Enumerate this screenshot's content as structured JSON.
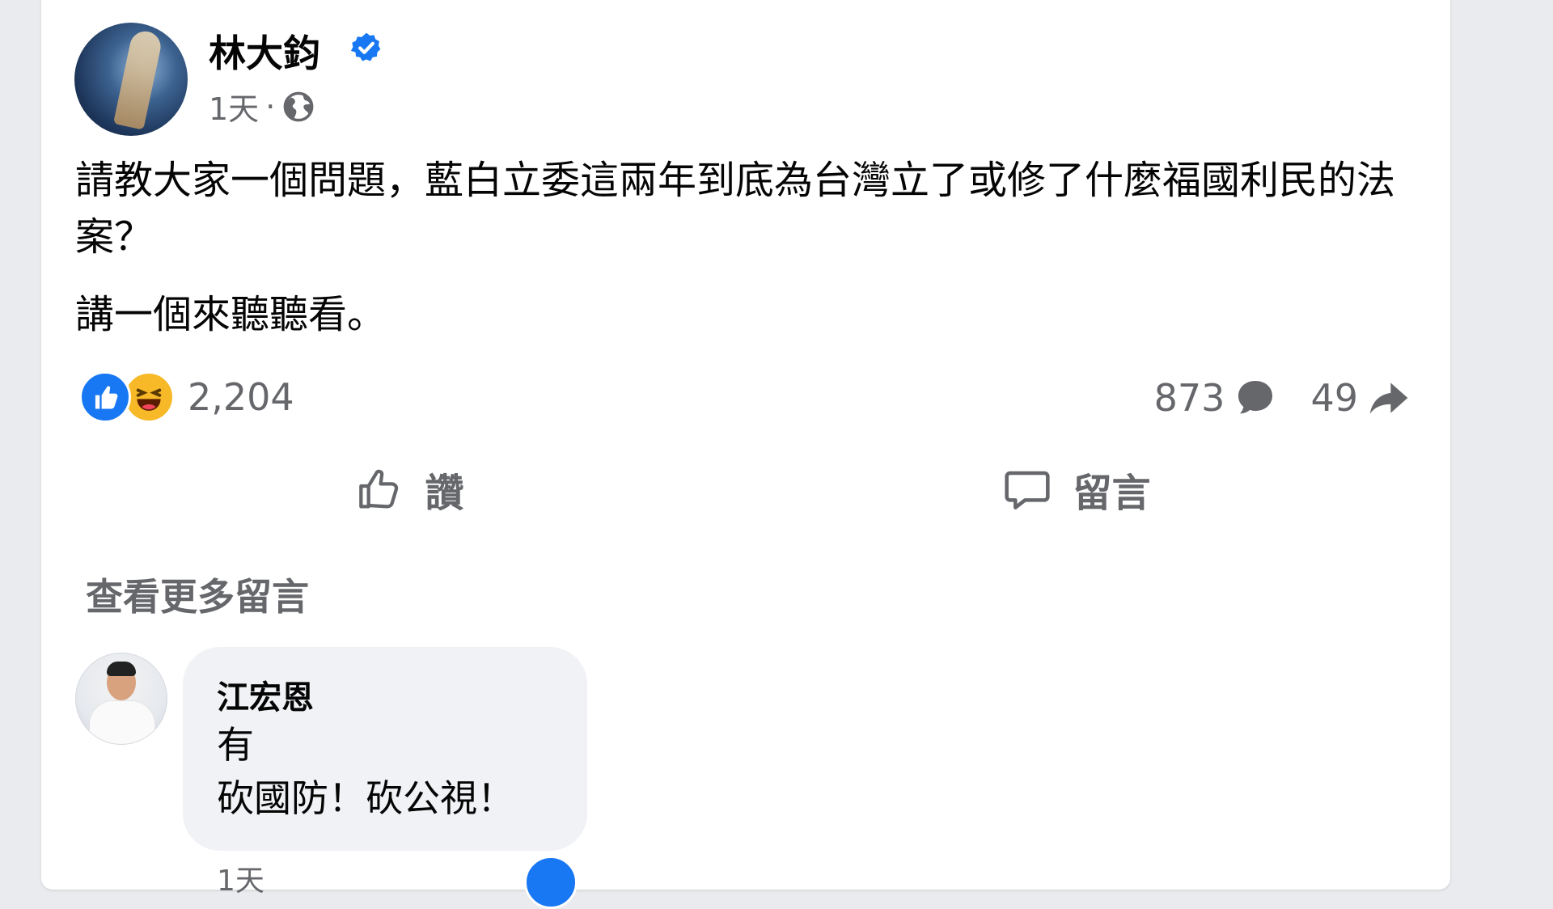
{
  "post": {
    "author": "林大鈞",
    "time": "1天",
    "separator": "·",
    "paragraphs": [
      "請教大家一個問題，藍白立委這兩年到底為台灣立了或修了什麼福國利民的法案？",
      "講一個來聽聽看。"
    ],
    "reaction_count": "2,204",
    "comment_count": "873",
    "share_count": "49"
  },
  "actions": {
    "like_label": "讚",
    "comment_label": "留言"
  },
  "comments": {
    "more_label": "查看更多留言",
    "items": [
      {
        "name": "江宏恩",
        "lines": [
          "有",
          "砍國防！砍公視！"
        ],
        "time": "1天"
      }
    ]
  },
  "colors": {
    "brand_blue": "#1877f2",
    "haha_yellow": "#f7b928",
    "secondary_text": "#65676b",
    "bubble_bg": "#f0f2f5"
  },
  "icons": [
    "verified-badge-icon",
    "globe-icon",
    "like-reaction-icon",
    "haha-reaction-icon",
    "comment-bubble-icon",
    "share-arrow-icon",
    "thumbs-up-icon",
    "comment-icon"
  ]
}
